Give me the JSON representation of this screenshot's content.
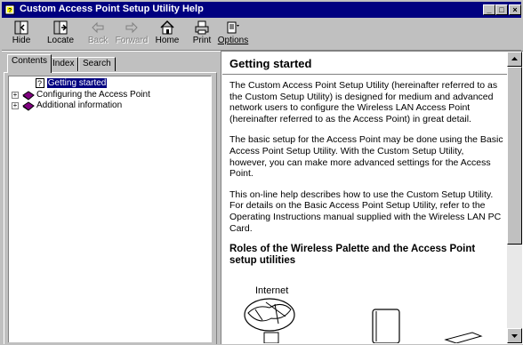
{
  "window": {
    "title": "Custom Access Point Setup Utility Help",
    "controls": {
      "minimize": "_",
      "maximize": "□",
      "close": "×"
    }
  },
  "toolbar": {
    "buttons": [
      {
        "label": "Hide",
        "icon": "hide-icon",
        "enabled": true
      },
      {
        "label": "Locate",
        "icon": "locate-icon",
        "enabled": true
      },
      {
        "label": "Back",
        "icon": "back-arrow-icon",
        "enabled": false
      },
      {
        "label": "Forward",
        "icon": "forward-arrow-icon",
        "enabled": false
      },
      {
        "label": "Home",
        "icon": "home-icon",
        "enabled": true
      },
      {
        "label": "Print",
        "icon": "printer-icon",
        "enabled": true
      },
      {
        "label": "Options",
        "icon": "options-icon",
        "enabled": true
      }
    ]
  },
  "nav": {
    "tabs": [
      {
        "label": "Contents",
        "active": true
      },
      {
        "label": "Index",
        "active": false
      },
      {
        "label": "Search",
        "active": false
      }
    ],
    "tree": [
      {
        "label": "Getting started",
        "icon": "help-page-icon",
        "expander": "",
        "selected": true
      },
      {
        "label": "Configuring the Access Point",
        "icon": "book-icon",
        "expander": "+",
        "selected": false
      },
      {
        "label": "Additional information",
        "icon": "book-icon",
        "expander": "+",
        "selected": false
      }
    ]
  },
  "content": {
    "title": "Getting started",
    "paragraphs": [
      "The Custom Access Point Setup Utility (hereinafter referred to as the Custom Setup Utility) is designed for medium and advanced network users to configure the Wireless LAN Access Point (hereinafter referred to as the Access Point) in great detail.",
      "The basic setup for the Access Point may be done using the Basic Access Point Setup Utility. With the Custom Setup Utility, however, you can make more advanced settings for the Access Point.",
      "This on-line help describes how to use the Custom Setup Utility. For details on the Basic Access Point Setup Utility, refer to the Operating Instructions manual supplied with the Wireless LAN PC Card."
    ],
    "subheading": "Roles of the Wireless Palette and the Access Point setup utilities",
    "figure_label": "Internet"
  },
  "colors": {
    "titlebar": "#000080",
    "face": "#c0c0c0",
    "selection": "#000080"
  }
}
